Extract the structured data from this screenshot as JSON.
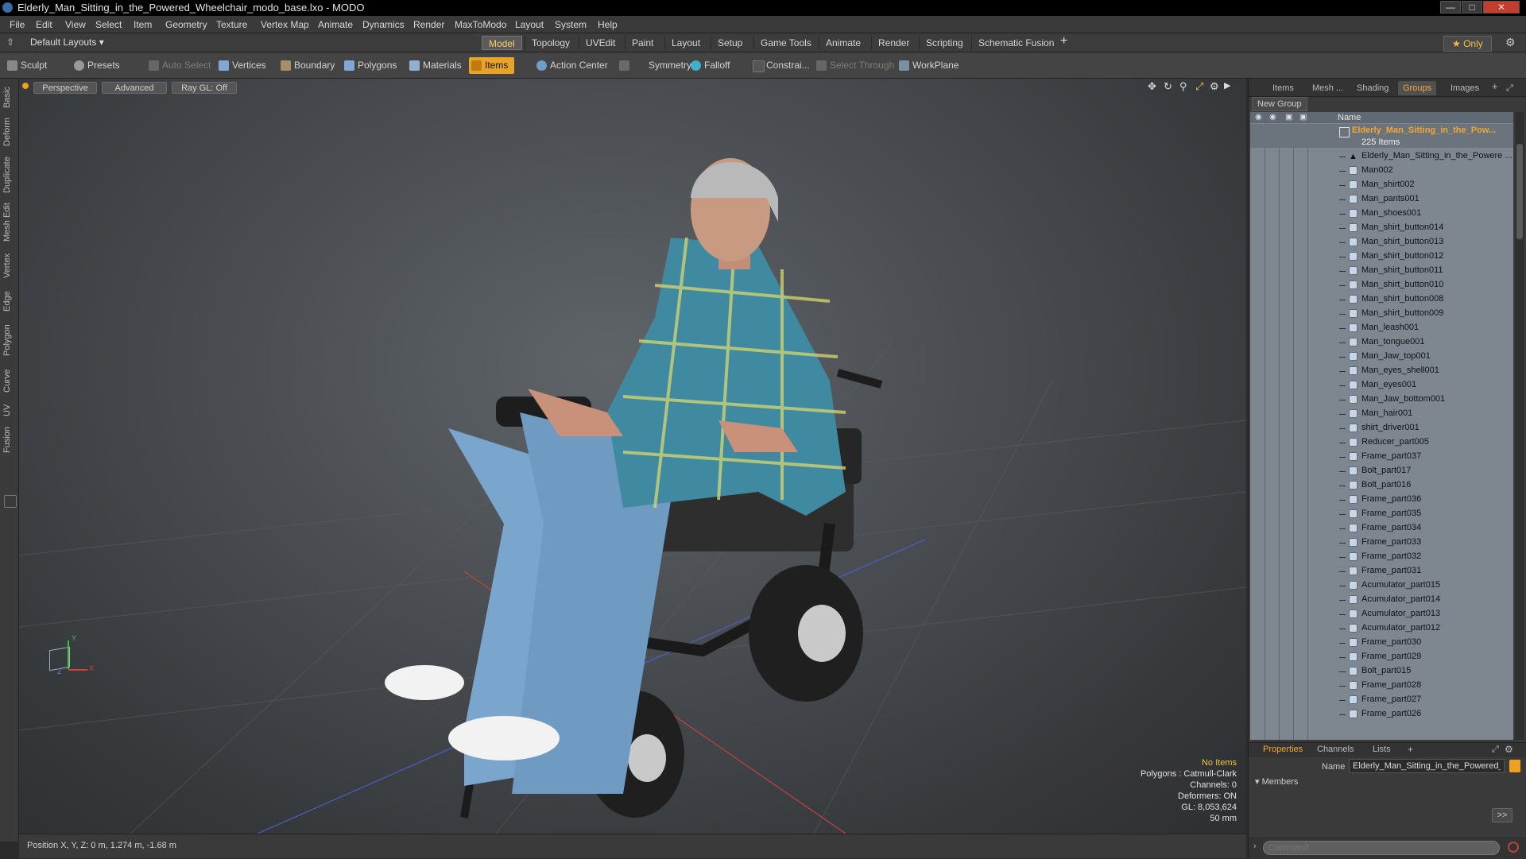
{
  "window": {
    "title": "Elderly_Man_Sitting_in_the_Powered_Wheelchair_modo_base.lxo - MODO",
    "controls": [
      "—",
      "□",
      "✕"
    ]
  },
  "menu": [
    "File",
    "Edit",
    "View",
    "Select",
    "Item",
    "Geometry",
    "Texture",
    "Vertex Map",
    "Animate",
    "Dynamics",
    "Render",
    "MaxToModo",
    "Layout",
    "System",
    "Help"
  ],
  "layout_bar": {
    "layout_select": "Default Layouts ▾",
    "tabs": [
      "Model",
      "Topology",
      "UVEdit",
      "Paint",
      "Layout",
      "Setup",
      "Game Tools",
      "Animate",
      "Render",
      "Scripting",
      "Schematic Fusion"
    ],
    "active_tab": "Model",
    "add": "+",
    "only": "★ Only"
  },
  "toolbar": {
    "sculpt": "Sculpt",
    "presets": "Presets",
    "auto_select": "Auto Select",
    "vertices": "Vertices",
    "boundary": "Boundary",
    "polygons": "Polygons",
    "materials": "Materials",
    "items": "Items",
    "action_center": "Action Center",
    "symmetry": "Symmetry",
    "falloff": "Falloff",
    "constraints": "Constrai...",
    "select_through": "Select Through",
    "workplane": "WorkPlane"
  },
  "left_tabs": [
    "Basic",
    "Deform",
    "Duplicate",
    "Mesh Edit",
    "Vertex",
    "Edge",
    "Polygon",
    "Curve",
    "UV",
    "Fusion"
  ],
  "viewport": {
    "view": "Perspective",
    "mode": "Advanced",
    "raygl": "Ray GL: Off",
    "info": {
      "no_items": "No Items",
      "polygons": "Polygons : Catmull-Clark",
      "channels": "Channels: 0",
      "deformers": "Deformers: ON",
      "gl": "GL: 8,053,624",
      "lens": "50 mm"
    },
    "axis": {
      "x": "X",
      "y": "Y",
      "z": "Z"
    }
  },
  "status": {
    "position": "Position X, Y, Z:  0 m, 1.274 m, -1.68 m"
  },
  "right_panel": {
    "tabs": [
      "Items",
      "Mesh ...",
      "Shading",
      "Groups",
      "Images"
    ],
    "active_tab": "Groups",
    "new_group": "New Group",
    "column_name": "Name",
    "group": {
      "name": "Elderly_Man_Sitting_in_the_Pow...",
      "count": "225 Items"
    },
    "items": [
      "Elderly_Man_Sitting_in_the_Powere ...",
      "Man002",
      "Man_shirt002",
      "Man_pants001",
      "Man_shoes001",
      "Man_shirt_button014",
      "Man_shirt_button013",
      "Man_shirt_button012",
      "Man_shirt_button011",
      "Man_shirt_button010",
      "Man_shirt_button008",
      "Man_shirt_button009",
      "Man_leash001",
      "Man_tongue001",
      "Man_Jaw_top001",
      "Man_eyes_shell001",
      "Man_eyes001",
      "Man_Jaw_bottom001",
      "Man_hair001",
      "shirt_driver001",
      "Reducer_part005",
      "Frame_part037",
      "Bolt_part017",
      "Bolt_part016",
      "Frame_part036",
      "Frame_part035",
      "Frame_part034",
      "Frame_part033",
      "Frame_part032",
      "Frame_part031",
      "Acumulator_part015",
      "Acumulator_part014",
      "Acumulator_part013",
      "Acumulator_part012",
      "Frame_part030",
      "Frame_part029",
      "Bolt_part015",
      "Frame_part028",
      "Frame_part027",
      "Frame_part026"
    ],
    "properties_tabs": [
      "Properties",
      "Channels",
      "Lists"
    ],
    "props_add": "+",
    "name_label": "Name",
    "name_value": "Elderly_Man_Sitting_in_the_Powered_",
    "members": "Members",
    "arrow_btn": ">>",
    "command_placeholder": "Command"
  }
}
